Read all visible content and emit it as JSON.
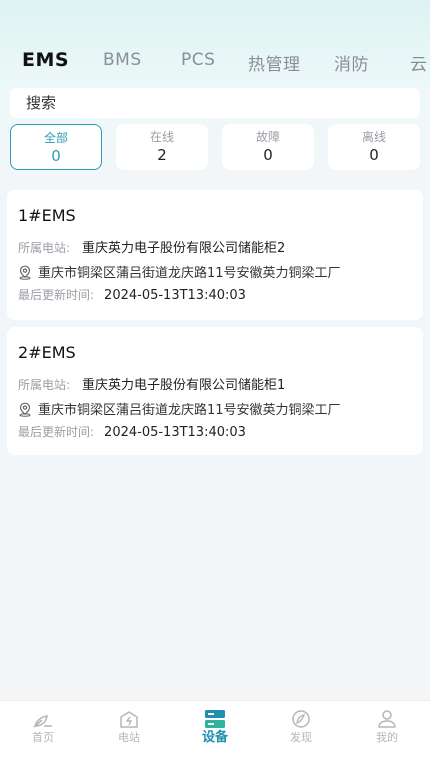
{
  "tabs": [
    {
      "label": "EMS",
      "active": true
    },
    {
      "label": "BMS",
      "active": false
    },
    {
      "label": "PCS",
      "active": false
    },
    {
      "label": "热管理",
      "active": false
    },
    {
      "label": "消防",
      "active": false
    },
    {
      "label": "云",
      "active": false
    }
  ],
  "search": {
    "placeholder": "搜索"
  },
  "filters": [
    {
      "label": "全部",
      "count": "0",
      "active": true
    },
    {
      "label": "在线",
      "count": "2",
      "active": false
    },
    {
      "label": "故障",
      "count": "0",
      "active": false
    },
    {
      "label": "离线",
      "count": "0",
      "active": false
    }
  ],
  "devices": [
    {
      "name": "1#EMS",
      "station_label": "所属电站:",
      "station": "重庆英力电子股份有限公司储能柜2",
      "address": "重庆市铜梁区蒲吕街道龙庆路11号安徽英力铜梁工厂",
      "updated_label": "最后更新时间:",
      "updated": "2024-05-13T13:40:03"
    },
    {
      "name": "2#EMS",
      "station_label": "所属电站:",
      "station": "重庆英力电子股份有限公司储能柜1",
      "address": "重庆市铜梁区蒲吕街道龙庆路11号安徽英力铜梁工厂",
      "updated_label": "最后更新时间:",
      "updated": "2024-05-13T13:40:03"
    }
  ],
  "nav": [
    {
      "label": "首页",
      "icon": "home-leaf-icon",
      "active": false
    },
    {
      "label": "电站",
      "icon": "station-icon",
      "active": false
    },
    {
      "label": "设备",
      "icon": "device-icon",
      "active": true
    },
    {
      "label": "发现",
      "icon": "discover-icon",
      "active": false
    },
    {
      "label": "我的",
      "icon": "profile-icon",
      "active": false
    }
  ],
  "colors": {
    "accent": "#2a9fb8",
    "nav_active": "#1f8fb0",
    "muted": "#9a9ea5"
  }
}
